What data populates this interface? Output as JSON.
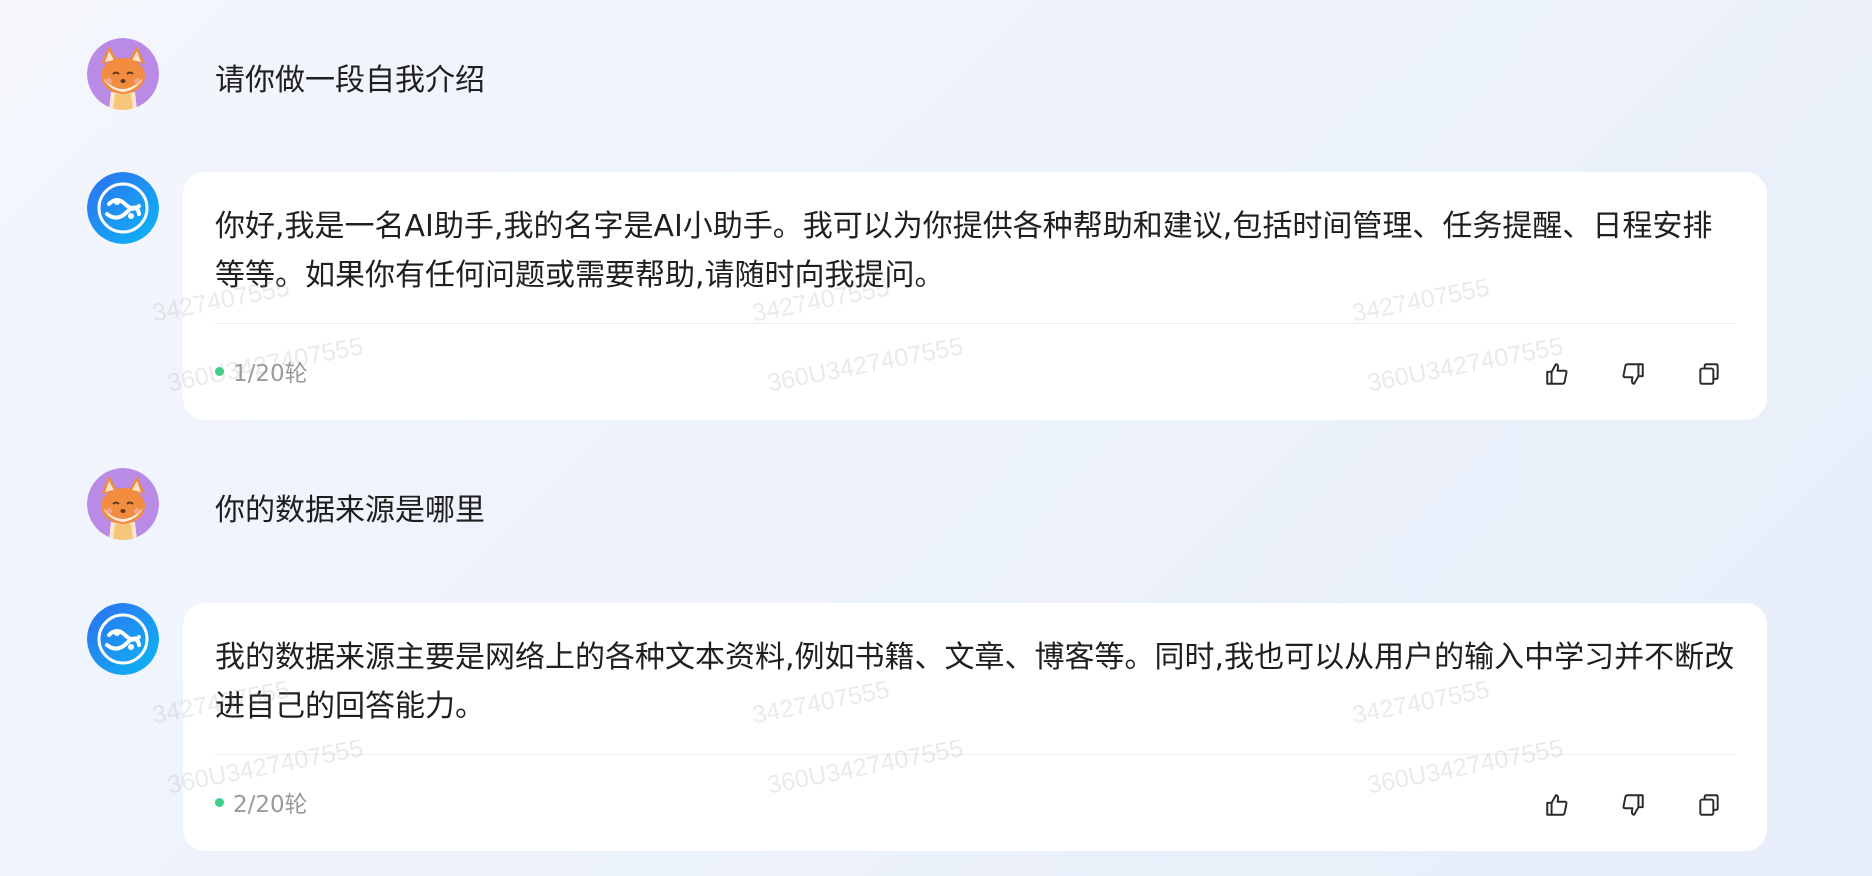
{
  "messages": [
    {
      "role": "user",
      "avatar": "fox-avatar-icon",
      "text": "请你做一段自我介绍"
    },
    {
      "role": "assistant",
      "avatar": "ai-assistant-logo-icon",
      "text": "你好,我是一名AI助手,我的名字是AI小助手。我可以为你提供各种帮助和建议,包括时间管理、任务提醒、日程安排等等。如果你有任何问题或需要帮助,请随时向我提问。",
      "round": "1/20轮",
      "actions": [
        "thumbs-up-icon",
        "thumbs-down-icon",
        "copy-icon"
      ]
    },
    {
      "role": "user",
      "avatar": "fox-avatar-icon",
      "text": "你的数据来源是哪里"
    },
    {
      "role": "assistant",
      "avatar": "ai-assistant-logo-icon",
      "text": "我的数据来源主要是网络上的各种文本资料,例如书籍、文章、博客等。同时,我也可以从用户的输入中学习并不断改进自己的回答能力。",
      "round": "2/20轮",
      "actions": [
        "thumbs-up-icon",
        "thumbs-down-icon",
        "copy-icon"
      ]
    }
  ],
  "watermark": {
    "short": "3427407555",
    "long": "360U3427407555"
  },
  "colors": {
    "round_dot": "#3fd08a",
    "card_bg": "#ffffff",
    "avatar_user_bg": "#b98be6",
    "avatar_ai_bg": "#1e88f5"
  }
}
